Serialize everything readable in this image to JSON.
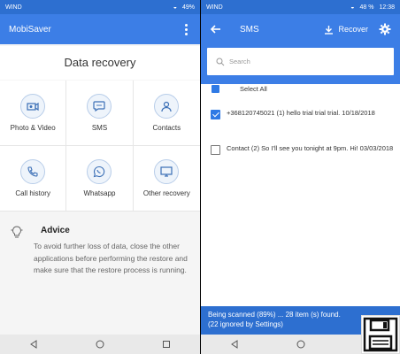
{
  "left": {
    "status": {
      "carrier": "WIND",
      "battery": "49%"
    },
    "appbar": {
      "title": "MobiSaver"
    },
    "heading": "Data recovery",
    "tiles": [
      {
        "label": "Photo & Video",
        "icon": "photo-video-icon"
      },
      {
        "label": "SMS",
        "icon": "sms-icon"
      },
      {
        "label": "Contacts",
        "icon": "contacts-icon"
      },
      {
        "label": "Call history",
        "icon": "call-history-icon"
      },
      {
        "label": "Whatsapp",
        "icon": "whatsapp-icon"
      },
      {
        "label": "Other recovery",
        "icon": "other-recovery-icon"
      }
    ],
    "advice": {
      "title": "Advice",
      "text": "To avoid further loss of data, close the other applications before performing the restore and make sure that the restore process is running."
    }
  },
  "right": {
    "status": {
      "carrier": "WIND",
      "battery": "48 %",
      "time": "12:38"
    },
    "appbar": {
      "title": "SMS",
      "recover_label": "Recover"
    },
    "search": {
      "placeholder": "Search"
    },
    "select_all": "Select All",
    "messages": [
      {
        "text": "+368120745021 (1) hello trial trial trial. 10/18/2018",
        "checked": true
      },
      {
        "text": "Contact (2) So I'll see you tonight at 9pm. Hi! 03/03/2018",
        "checked": false
      }
    ],
    "footer": {
      "line1": "Being scanned (89%) ... 28 item (s) found.",
      "line2": "(22 ignored by Settings)"
    },
    "scan_progress": 0.89
  },
  "colors": {
    "primary": "#3c7ee6",
    "primary_dark": "#2d6fd0",
    "accent": "#2f7ae5"
  }
}
